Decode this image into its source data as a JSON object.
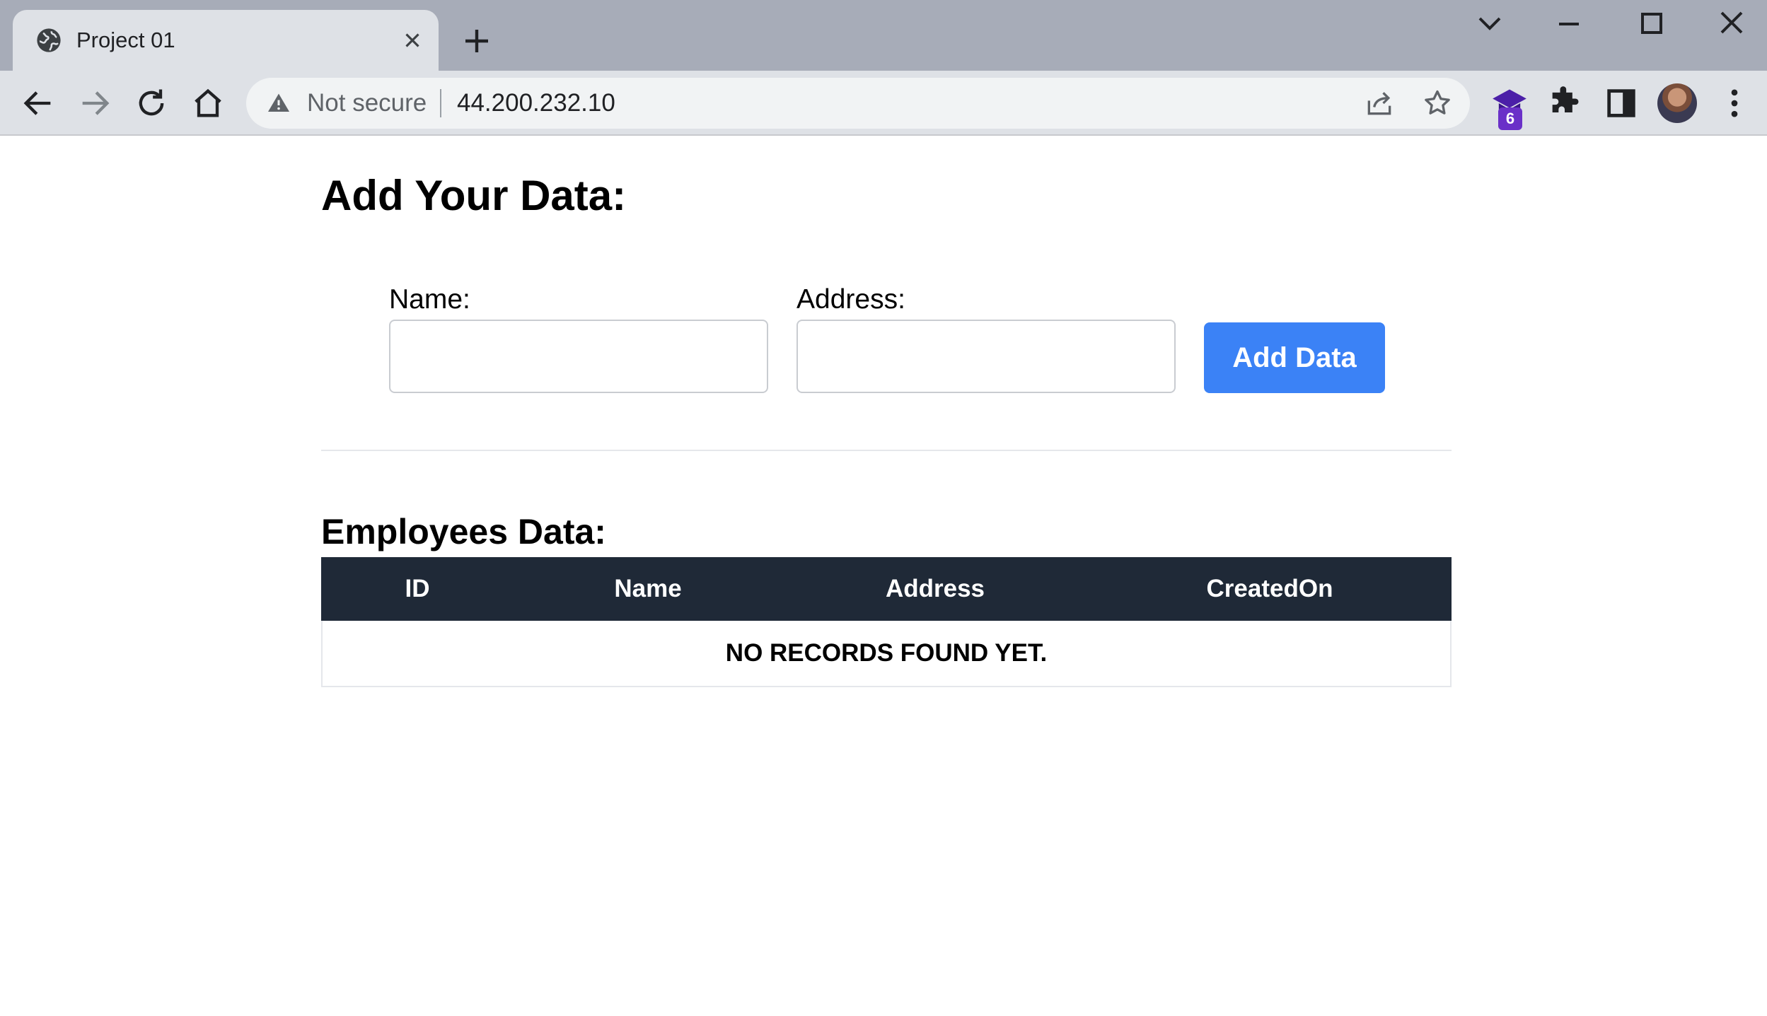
{
  "browser": {
    "tab_title": "Project 01",
    "omnibox": {
      "security_label": "Not secure",
      "url": "44.200.232.10"
    },
    "extension_badge_count": "6"
  },
  "page": {
    "title": "Add Your Data:",
    "form": {
      "name_label": "Name:",
      "name_value": "",
      "address_label": "Address:",
      "address_value": "",
      "submit_label": "Add Data"
    },
    "employees": {
      "title": "Employees Data:",
      "columns": [
        "ID",
        "Name",
        "Address",
        "CreatedOn"
      ],
      "empty_message": "NO RECORDS FOUND YET."
    }
  },
  "colors": {
    "accent": "#3b82f6",
    "table_header": "#1f2937"
  }
}
